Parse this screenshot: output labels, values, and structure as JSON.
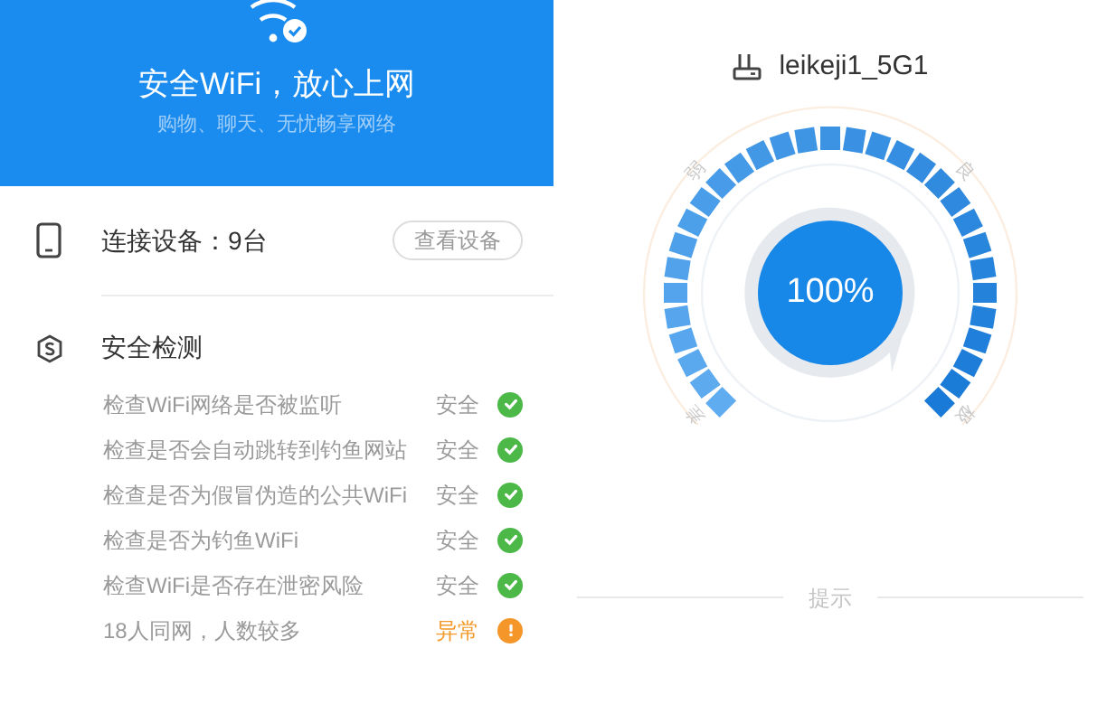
{
  "header": {
    "title": "安全WiFi，放心上网",
    "subtitle": "购物、聊天、无忧畅享网络"
  },
  "devices": {
    "label": "连接设备：9台",
    "button": "查看设备"
  },
  "security": {
    "title": "安全检测",
    "checks": [
      {
        "label": "检查WiFi网络是否被监听",
        "result": "安全",
        "kind": "safe"
      },
      {
        "label": "检查是否会自动跳转到钓鱼网站",
        "result": "安全",
        "kind": "safe"
      },
      {
        "label": "检查是否为假冒伪造的公共WiFi",
        "result": "安全",
        "kind": "safe"
      },
      {
        "label": "检查是否为钓鱼WiFi",
        "result": "安全",
        "kind": "safe"
      },
      {
        "label": "检查WiFi是否存在泄密风险",
        "result": "安全",
        "kind": "safe"
      },
      {
        "label": "18人同网，人数较多",
        "result": "异常",
        "kind": "warning"
      }
    ]
  },
  "network": {
    "ssid": "leikeji1_5G1",
    "gauge": {
      "reading": "100%",
      "scale_labels": [
        "差",
        "弱",
        "良",
        "极"
      ]
    }
  },
  "tip": {
    "label": "提示"
  }
}
